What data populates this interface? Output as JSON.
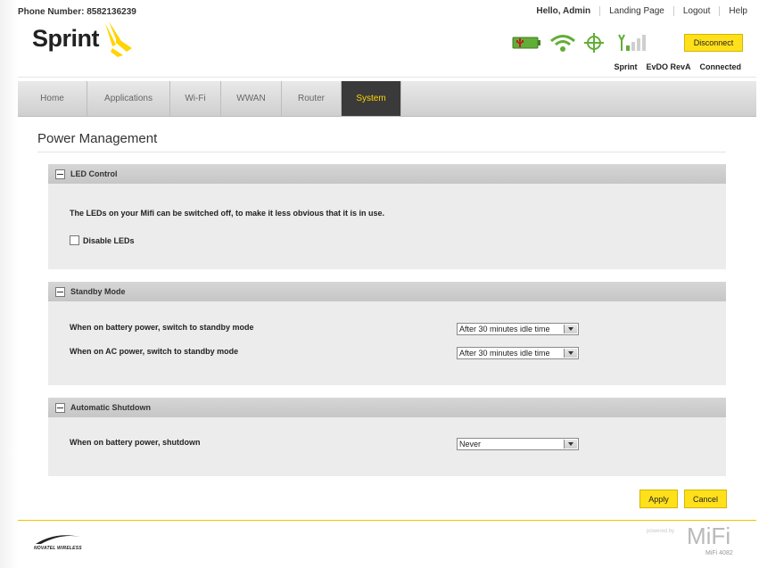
{
  "header": {
    "phone_label": "Phone Number: 8582136239",
    "links": [
      "Hello, Admin",
      "Landing Page",
      "Logout",
      "Help"
    ],
    "logo_text": "Sprint",
    "disconnect_label": "Disconnect",
    "status_words": [
      "Sprint",
      "EvDO RevA",
      "Connected"
    ],
    "icons": [
      "battery-icon",
      "wifi-icon",
      "gps-icon",
      "signal-icon"
    ],
    "accent": "#ffe01b"
  },
  "nav": {
    "tabs": [
      "Home",
      "Applications",
      "Wi-Fi",
      "WWAN",
      "Router",
      "System"
    ],
    "active": "System"
  },
  "page": {
    "title": "Power Management"
  },
  "led": {
    "header": "LED Control",
    "description": "The LEDs on your Mifi can be switched off, to make it less obvious that it is in use.",
    "checkbox_label": "Disable LEDs",
    "checked": false
  },
  "standby": {
    "header": "Standby Mode",
    "battery_label": "When on battery power, switch to standby mode",
    "battery_value": "After 30 minutes idle time",
    "ac_label": "When on AC power, switch to standby mode",
    "ac_value": "After 30 minutes idle time"
  },
  "shutdown": {
    "header": "Automatic Shutdown",
    "battery_label": "When on battery power, shutdown",
    "battery_value": "Never"
  },
  "actions": {
    "apply": "Apply",
    "cancel": "Cancel"
  },
  "footer": {
    "brand_left": "NOVATEL WIRELESS",
    "powered_by": "powered by",
    "mifi": "MiFi",
    "model": "MiFi 4082"
  }
}
